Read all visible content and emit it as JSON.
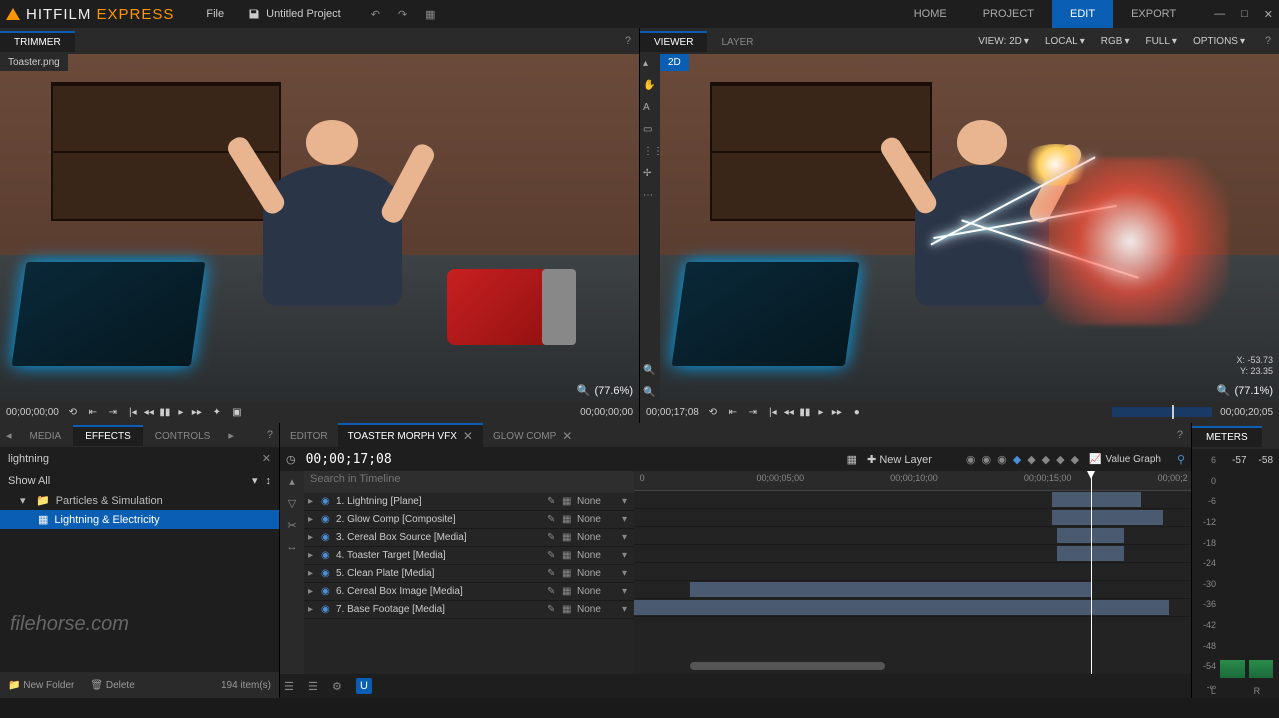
{
  "app": {
    "name_part1": "HITFILM",
    "name_part2": "EXPRESS"
  },
  "menu": {
    "file": "File",
    "project_title": "Untitled Project"
  },
  "top_tabs": {
    "home": "HOME",
    "project": "PROJECT",
    "edit": "EDIT",
    "export": "EXPORT"
  },
  "trimmer": {
    "title": "TRIMMER",
    "filename": "Toaster.png",
    "zoom": "(77.6%)",
    "timecode_left": "00;00;00;00",
    "timecode_right": "00;00;00;00"
  },
  "viewer": {
    "title": "VIEWER",
    "layer_tab": "LAYER",
    "mode": "2D",
    "zoom": "(77.1%)",
    "timecode_left": "00;00;17;08",
    "timecode_right": "00;00;20;05",
    "coord_x": "X: -53.73",
    "coord_y": "Y: 23.35",
    "view_label": "VIEW: 2D",
    "local": "LOCAL",
    "rgb": "RGB",
    "full": "FULL",
    "options": "OPTIONS"
  },
  "left": {
    "tabs": {
      "media": "MEDIA",
      "effects": "EFFECTS",
      "controls": "CONTROLS"
    },
    "search": "lightning",
    "filter": "Show All",
    "tree_parent": "Particles & Simulation",
    "tree_child": "Lightning & Electricity",
    "new_folder": "New Folder",
    "delete": "Delete",
    "item_count": "194 item(s)",
    "watermark": "filehorse.com"
  },
  "editor": {
    "tabs": {
      "editor": "EDITOR",
      "comp1": "TOASTER MORPH VFX",
      "comp2": "GLOW COMP"
    },
    "timecode": "00;00;17;08",
    "new_layer": "New Layer",
    "search_placeholder": "Search in Timeline",
    "value_graph": "Value Graph",
    "blend_none": "None",
    "ruler": [
      "0",
      "00;00;05;00",
      "00;00;10;00",
      "00;00;15;00",
      "00;00;2"
    ],
    "layers": [
      {
        "n": "1.",
        "name": "Lightning [Plane]"
      },
      {
        "n": "2.",
        "name": "Glow Comp [Composite]"
      },
      {
        "n": "3.",
        "name": "Cereal Box Source [Media]"
      },
      {
        "n": "4.",
        "name": "Toaster Target [Media]"
      },
      {
        "n": "5.",
        "name": "Clean Plate [Media]"
      },
      {
        "n": "6.",
        "name": "Cereal Box Image [Media]"
      },
      {
        "n": "7.",
        "name": "Base Footage [Media]"
      }
    ]
  },
  "meters": {
    "title": "METERS",
    "peak_l": "-57",
    "peak_r": "-58",
    "scale": [
      "6",
      "0",
      "-6",
      "-12",
      "-18",
      "-24",
      "-30",
      "-36",
      "-42",
      "-48",
      "-54",
      "-∞"
    ],
    "L": "L",
    "R": "R"
  }
}
